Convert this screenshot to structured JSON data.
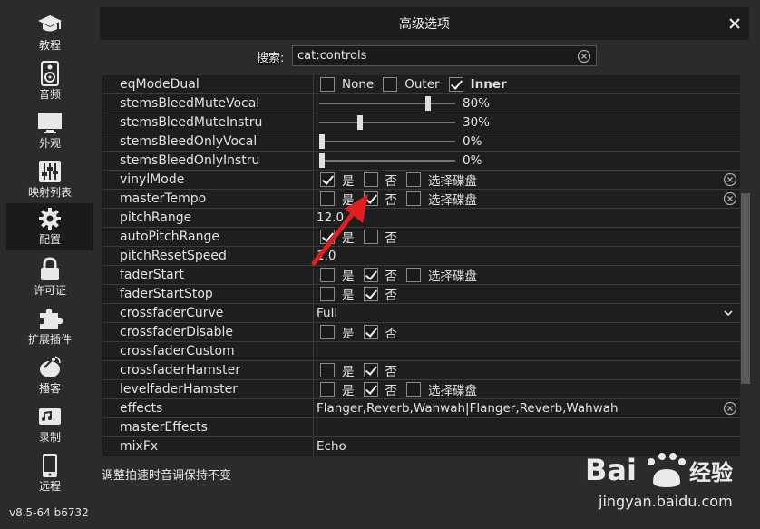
{
  "sidebar": {
    "items": [
      {
        "label": "教程",
        "icon": "graduation-cap-icon"
      },
      {
        "label": "音频",
        "icon": "speaker-icon"
      },
      {
        "label": "外观",
        "icon": "monitor-icon"
      },
      {
        "label": "映射列表",
        "icon": "sliders-icon"
      },
      {
        "label": "配置",
        "icon": "gear-icon",
        "active": true
      },
      {
        "label": "许可证",
        "icon": "lock-icon"
      },
      {
        "label": "扩展插件",
        "icon": "puzzle-icon"
      },
      {
        "label": "播客",
        "icon": "satellite-dish-icon"
      },
      {
        "label": "录制",
        "icon": "record-icon"
      },
      {
        "label": "远程",
        "icon": "phone-icon"
      }
    ],
    "version": "v8.5-64 b6732"
  },
  "window": {
    "title": "高级选项",
    "close_symbol": "✕"
  },
  "search": {
    "label_highlight": "搜索",
    "label_rest": ":",
    "value": "cat:controls"
  },
  "rows": [
    {
      "name": "eqModeDual",
      "type": "radio",
      "options": [
        {
          "label": "None",
          "checked": false
        },
        {
          "label": "Outer",
          "checked": false
        },
        {
          "label": "Inner",
          "checked": true,
          "bold": true
        }
      ]
    },
    {
      "name": "stemsBleedMuteVocal",
      "type": "slider",
      "value": 80,
      "text": "80%"
    },
    {
      "name": "stemsBleedMuteInstru",
      "type": "slider",
      "value": 30,
      "text": "30%"
    },
    {
      "name": "stemsBleedOnlyVocal",
      "type": "slider",
      "value": 0,
      "text": "0%"
    },
    {
      "name": "stemsBleedOnlyInstru",
      "type": "slider",
      "value": 0,
      "text": "0%"
    },
    {
      "name": "vinylMode",
      "type": "checks",
      "options": [
        {
          "label": "是",
          "checked": true
        },
        {
          "label": "否",
          "checked": false
        },
        {
          "label": "选择碟盘",
          "checked": false
        }
      ],
      "clear": true
    },
    {
      "name": "masterTempo",
      "type": "checks",
      "options": [
        {
          "label": "是",
          "checked": false
        },
        {
          "label": "否",
          "checked": true
        },
        {
          "label": "选择碟盘",
          "checked": false
        }
      ],
      "clear": true
    },
    {
      "name": "pitchRange",
      "type": "text",
      "text": "12.0"
    },
    {
      "name": "autoPitchRange",
      "type": "checks",
      "options": [
        {
          "label": "是",
          "checked": true
        },
        {
          "label": "否",
          "checked": false
        }
      ]
    },
    {
      "name": "pitchResetSpeed",
      "type": "text",
      "text": "1.0"
    },
    {
      "name": "faderStart",
      "type": "checks",
      "options": [
        {
          "label": "是",
          "checked": false
        },
        {
          "label": "否",
          "checked": true
        },
        {
          "label": "选择碟盘",
          "checked": false
        }
      ]
    },
    {
      "name": "faderStartStop",
      "type": "checks",
      "options": [
        {
          "label": "是",
          "checked": false
        },
        {
          "label": "否",
          "checked": true
        }
      ]
    },
    {
      "name": "crossfaderCurve",
      "type": "select",
      "text": "Full"
    },
    {
      "name": "crossfaderDisable",
      "type": "checks",
      "options": [
        {
          "label": "是",
          "checked": false
        },
        {
          "label": "否",
          "checked": true
        }
      ]
    },
    {
      "name": "crossfaderCustom",
      "type": "text",
      "text": ""
    },
    {
      "name": "crossfaderHamster",
      "type": "checks",
      "options": [
        {
          "label": "是",
          "checked": false
        },
        {
          "label": "否",
          "checked": true
        }
      ]
    },
    {
      "name": "levelfaderHamster",
      "type": "checks",
      "options": [
        {
          "label": "是",
          "checked": false
        },
        {
          "label": "否",
          "checked": true
        },
        {
          "label": "选择碟盘",
          "checked": false
        }
      ]
    },
    {
      "name": "effects",
      "type": "text",
      "text": "Flanger,Reverb,Wahwah|Flanger,Reverb,Wahwah",
      "clear": true
    },
    {
      "name": "masterEffects",
      "type": "text",
      "text": ""
    },
    {
      "name": "mixFx",
      "type": "text",
      "text": "Echo"
    }
  ],
  "status_text": "调整拍速时音调保持不变",
  "watermark": {
    "brand": "Bai 经验",
    "url": "jingyan.baidu.com"
  },
  "colors": {
    "annotation_arrow": "#e02020"
  }
}
